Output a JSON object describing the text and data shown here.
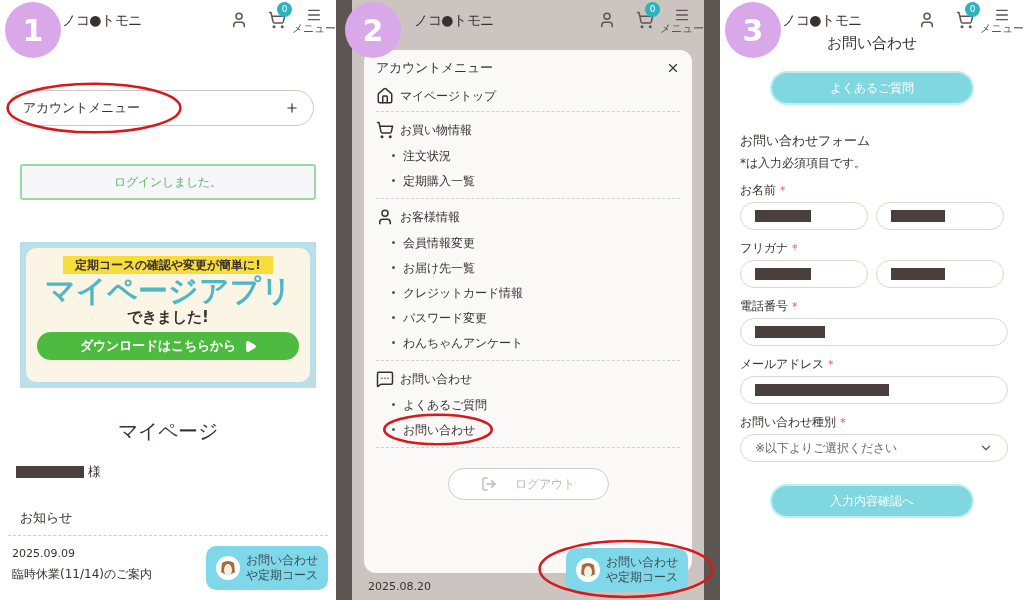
{
  "step_badges": [
    "1",
    "2",
    "3"
  ],
  "panel_1": {
    "header": {
      "logo": "ノコ●トモニ",
      "cart_count": "0",
      "menu_label": "メニュー"
    },
    "account_menu_toggle": {
      "label": "アカウントメニュー",
      "circled": true
    },
    "login_notice": "ログインしました。",
    "banner": {
      "ribbon": "定期コースの確認や変更が簡単に!",
      "headline": "マイページアプリ",
      "subline": "できました!",
      "button": "ダウンロードはこちらから"
    },
    "page_title": "マイページ",
    "customer_suffix": "様",
    "news": {
      "heading": "お知らせ",
      "items": [
        {
          "date": "2025.09.09",
          "title": "臨時休業(11/14)のご案内"
        }
      ]
    },
    "floating_button": {
      "lines": [
        "お問い合わせ",
        "や定期コース"
      ],
      "circled": false
    }
  },
  "panel_2": {
    "header": {
      "logo": "ノコ●トモニ",
      "cart_count": "0",
      "menu_label": "メニュー"
    },
    "account_menu": {
      "title": "アカウントメニュー",
      "sections": [
        {
          "title": "マイページトップ"
        },
        {
          "title": "お買い物情報",
          "items": [
            {
              "label": "注文状況",
              "circled": false
            },
            {
              "label": "定期購入一覧",
              "circled": false
            }
          ]
        },
        {
          "title": "お客様情報",
          "items": [
            {
              "label": "会員情報変更",
              "circled": false
            },
            {
              "label": "お届け先一覧",
              "circled": false
            },
            {
              "label": "クレジットカード情報",
              "circled": false
            },
            {
              "label": "パスワード変更",
              "circled": false
            },
            {
              "label": "わんちゃんアンケート",
              "circled": false
            }
          ]
        },
        {
          "title": "お問い合わせ",
          "items": [
            {
              "label": "よくあるご質問",
              "circled": false
            },
            {
              "label": "お問い合わせ",
              "circled": true
            }
          ]
        }
      ],
      "logout": "ログアウト"
    },
    "floating_button": {
      "lines": [
        "お問い合わせ",
        "や定期コース"
      ],
      "circled": true
    },
    "date": "2025.08.20"
  },
  "panel_3": {
    "header": {
      "logo": "ノコ●トモニ",
      "cart_count": "0",
      "menu_label": "メニュー"
    },
    "page_title": "お問い合わせ",
    "faq_button": "よくあるご質問",
    "form_title": "お問い合わせフォーム",
    "required_note": "*は入力必須項目です。",
    "fields": [
      {
        "label": "お名前",
        "required_mark": "*",
        "kind": "pair"
      },
      {
        "label": "フリガナ",
        "required_mark": "*",
        "kind": "pair"
      },
      {
        "label": "電話番号",
        "required_mark": "*",
        "kind": "single"
      },
      {
        "label": "メールアドレス",
        "required_mark": "*",
        "kind": "single"
      },
      {
        "label": "お問い合わせ種別",
        "required_mark": "*",
        "kind": "select",
        "placeholder": "※以下よりご選択ください"
      }
    ],
    "submit": "入力内容確認へ"
  }
}
